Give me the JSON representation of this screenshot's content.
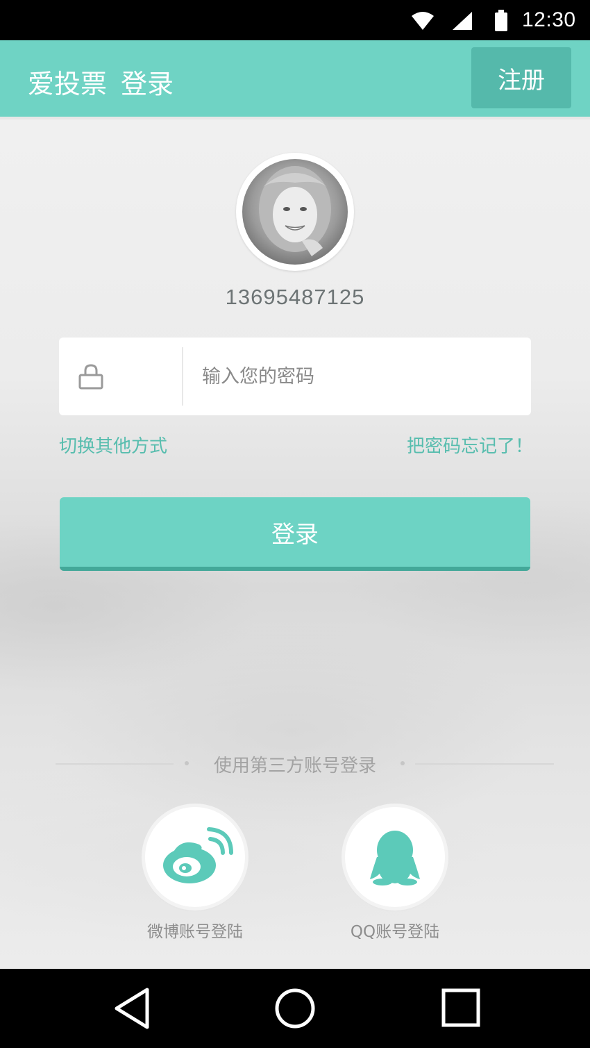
{
  "status_bar": {
    "time": "12:30",
    "icons": [
      "wifi-icon",
      "cell-signal-icon",
      "battery-icon"
    ]
  },
  "app_bar": {
    "app_name": "爱投票",
    "page_title": "登录",
    "register_label": "注册"
  },
  "account": {
    "avatar": "avatar",
    "phone_number": "13695487125"
  },
  "password_field": {
    "icon": "lock-icon",
    "placeholder": "输入您的密码",
    "value": ""
  },
  "links": {
    "switch_method": "切换其他方式",
    "forgot_password": "把密码忘记了！"
  },
  "login_button": {
    "label": "登录"
  },
  "third_party": {
    "divider_label": "使用第三方账号登录",
    "options": [
      {
        "label": "微博账号登陆",
        "icon": "weibo-icon"
      },
      {
        "label": "QQ账号登陆",
        "icon": "qq-penguin-icon"
      }
    ]
  },
  "nav_bar": {
    "icons": [
      "back-icon",
      "home-icon",
      "recent-apps-icon"
    ]
  },
  "colors": {
    "accent": "#6fd3c4",
    "accent_dark": "#55b9ab",
    "link": "#57bdae",
    "icon_teal": "#5ccab9"
  }
}
